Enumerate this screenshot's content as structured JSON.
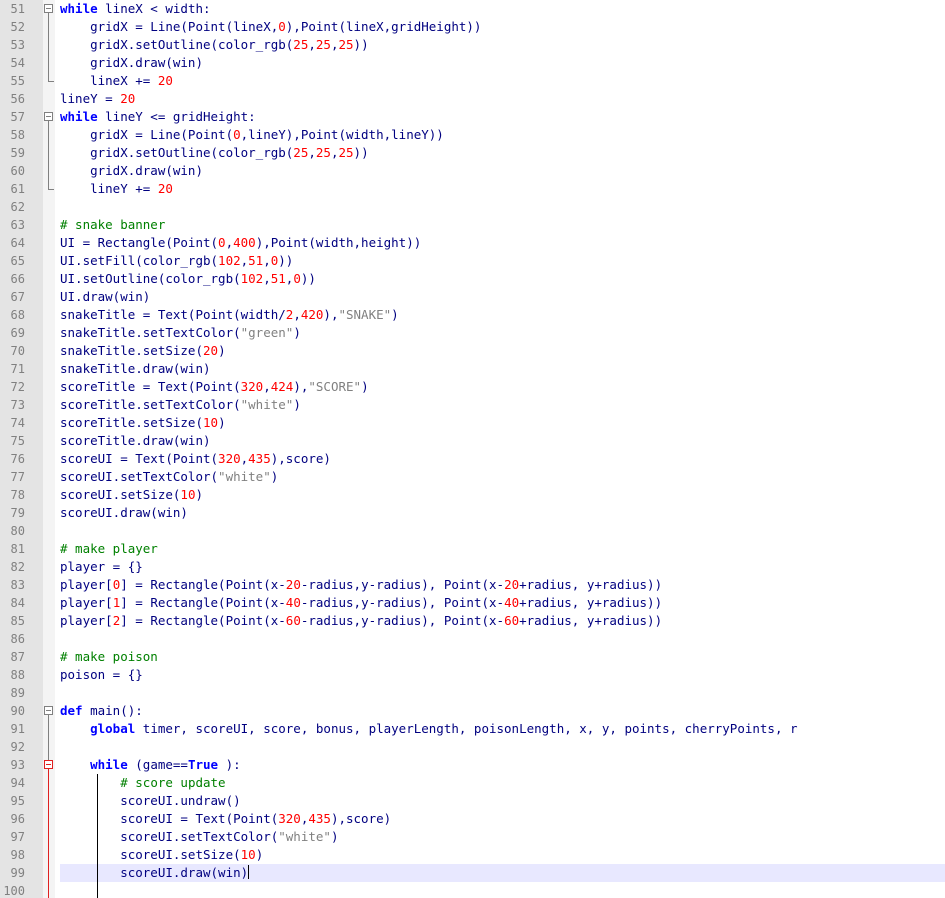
{
  "editor": {
    "lines": [
      {
        "n": "51",
        "segs": [
          [
            "kw",
            "while"
          ],
          [
            "",
            "lineX < width:"
          ]
        ]
      },
      {
        "n": "52",
        "segs": [
          [
            "",
            "    gridX = Line(Point(lineX,"
          ],
          [
            "nm",
            "0"
          ],
          [
            "",
            "),Point(lineX,gridHeight))"
          ]
        ]
      },
      {
        "n": "53",
        "segs": [
          [
            "",
            "    gridX.setOutline(color_rgb("
          ],
          [
            "nm",
            "25"
          ],
          [
            "",
            ","
          ],
          [
            "nm",
            "25"
          ],
          [
            "",
            ","
          ],
          [
            "nm",
            "25"
          ],
          [
            "",
            "))"
          ]
        ]
      },
      {
        "n": "54",
        "segs": [
          [
            "",
            "    gridX.draw(win)"
          ]
        ]
      },
      {
        "n": "55",
        "segs": [
          [
            "",
            "    lineX += "
          ],
          [
            "nm",
            "20"
          ]
        ]
      },
      {
        "n": "56",
        "segs": [
          [
            "",
            "lineY = "
          ],
          [
            "nm",
            "20"
          ]
        ]
      },
      {
        "n": "57",
        "segs": [
          [
            "kw",
            "while"
          ],
          [
            "",
            "lineY <= gridHeight:"
          ]
        ]
      },
      {
        "n": "58",
        "segs": [
          [
            "",
            "    gridX = Line(Point("
          ],
          [
            "nm",
            "0"
          ],
          [
            "",
            ",lineY),Point(width,lineY))"
          ]
        ]
      },
      {
        "n": "59",
        "segs": [
          [
            "",
            "    gridX.setOutline(color_rgb("
          ],
          [
            "nm",
            "25"
          ],
          [
            "",
            ","
          ],
          [
            "nm",
            "25"
          ],
          [
            "",
            ","
          ],
          [
            "nm",
            "25"
          ],
          [
            "",
            "))"
          ]
        ]
      },
      {
        "n": "60",
        "segs": [
          [
            "",
            "    gridX.draw(win)"
          ]
        ]
      },
      {
        "n": "61",
        "segs": [
          [
            "",
            "    lineY += "
          ],
          [
            "nm",
            "20"
          ]
        ]
      },
      {
        "n": "62",
        "segs": []
      },
      {
        "n": "63",
        "segs": [
          [
            "cm",
            "# snake banner"
          ]
        ]
      },
      {
        "n": "64",
        "segs": [
          [
            "",
            "UI = Rectangle(Point("
          ],
          [
            "nm",
            "0"
          ],
          [
            "",
            ","
          ],
          [
            "nm",
            "400"
          ],
          [
            "",
            "),Point(width,height))"
          ]
        ]
      },
      {
        "n": "65",
        "segs": [
          [
            "",
            "UI.setFill(color_rgb("
          ],
          [
            "nm",
            "102"
          ],
          [
            "",
            ","
          ],
          [
            "nm",
            "51"
          ],
          [
            "",
            ","
          ],
          [
            "nm",
            "0"
          ],
          [
            "",
            "))"
          ]
        ]
      },
      {
        "n": "66",
        "segs": [
          [
            "",
            "UI.setOutline(color_rgb("
          ],
          [
            "nm",
            "102"
          ],
          [
            "",
            ","
          ],
          [
            "nm",
            "51"
          ],
          [
            "",
            ","
          ],
          [
            "nm",
            "0"
          ],
          [
            "",
            "))"
          ]
        ]
      },
      {
        "n": "67",
        "segs": [
          [
            "",
            "UI.draw(win)"
          ]
        ]
      },
      {
        "n": "68",
        "segs": [
          [
            "",
            "snakeTitle = Text(Point(width/"
          ],
          [
            "nm",
            "2"
          ],
          [
            "",
            ","
          ],
          [
            "nm",
            "420"
          ],
          [
            "",
            "),"
          ],
          [
            "st",
            "\"SNAKE\""
          ],
          [
            "",
            ")"
          ]
        ]
      },
      {
        "n": "69",
        "segs": [
          [
            "",
            "snakeTitle.setTextColor("
          ],
          [
            "st",
            "\"green\""
          ],
          [
            "",
            ")"
          ]
        ]
      },
      {
        "n": "70",
        "segs": [
          [
            "",
            "snakeTitle.setSize("
          ],
          [
            "nm",
            "20"
          ],
          [
            "",
            ")"
          ]
        ]
      },
      {
        "n": "71",
        "segs": [
          [
            "",
            "snakeTitle.draw(win)"
          ]
        ]
      },
      {
        "n": "72",
        "segs": [
          [
            "",
            "scoreTitle = Text(Point("
          ],
          [
            "nm",
            "320"
          ],
          [
            "",
            ","
          ],
          [
            "nm",
            "424"
          ],
          [
            "",
            "),"
          ],
          [
            "st",
            "\"SCORE\""
          ],
          [
            "",
            ")"
          ]
        ]
      },
      {
        "n": "73",
        "segs": [
          [
            "",
            "scoreTitle.setTextColor("
          ],
          [
            "st",
            "\"white\""
          ],
          [
            "",
            ")"
          ]
        ]
      },
      {
        "n": "74",
        "segs": [
          [
            "",
            "scoreTitle.setSize("
          ],
          [
            "nm",
            "10"
          ],
          [
            "",
            ")"
          ]
        ]
      },
      {
        "n": "75",
        "segs": [
          [
            "",
            "scoreTitle.draw(win)"
          ]
        ]
      },
      {
        "n": "76",
        "segs": [
          [
            "",
            "scoreUI = Text(Point("
          ],
          [
            "nm",
            "320"
          ],
          [
            "",
            ","
          ],
          [
            "nm",
            "435"
          ],
          [
            "",
            "),score)"
          ]
        ]
      },
      {
        "n": "77",
        "segs": [
          [
            "",
            "scoreUI.setTextColor("
          ],
          [
            "st",
            "\"white\""
          ],
          [
            "",
            ")"
          ]
        ]
      },
      {
        "n": "78",
        "segs": [
          [
            "",
            "scoreUI.setSize("
          ],
          [
            "nm",
            "10"
          ],
          [
            "",
            ")"
          ]
        ]
      },
      {
        "n": "79",
        "segs": [
          [
            "",
            "scoreUI.draw(win)"
          ]
        ]
      },
      {
        "n": "80",
        "segs": []
      },
      {
        "n": "81",
        "segs": [
          [
            "cm",
            "# make player"
          ]
        ]
      },
      {
        "n": "82",
        "segs": [
          [
            "",
            "player = {}"
          ]
        ]
      },
      {
        "n": "83",
        "segs": [
          [
            "",
            "player["
          ],
          [
            "nm",
            "0"
          ],
          [
            "",
            "] = Rectangle(Point(x-"
          ],
          [
            "nm",
            "20"
          ],
          [
            "",
            "-radius,y-radius), Point(x-"
          ],
          [
            "nm",
            "20"
          ],
          [
            "",
            "+radius, y+radius))"
          ]
        ]
      },
      {
        "n": "84",
        "segs": [
          [
            "",
            "player["
          ],
          [
            "nm",
            "1"
          ],
          [
            "",
            "] = Rectangle(Point(x-"
          ],
          [
            "nm",
            "40"
          ],
          [
            "",
            "-radius,y-radius), Point(x-"
          ],
          [
            "nm",
            "40"
          ],
          [
            "",
            "+radius, y+radius))"
          ]
        ]
      },
      {
        "n": "85",
        "segs": [
          [
            "",
            "player["
          ],
          [
            "nm",
            "2"
          ],
          [
            "",
            "] = Rectangle(Point(x-"
          ],
          [
            "nm",
            "60"
          ],
          [
            "",
            "-radius,y-radius), Point(x-"
          ],
          [
            "nm",
            "60"
          ],
          [
            "",
            "+radius, y+radius))"
          ]
        ]
      },
      {
        "n": "86",
        "segs": []
      },
      {
        "n": "87",
        "segs": [
          [
            "cm",
            "# make poison"
          ]
        ]
      },
      {
        "n": "88",
        "segs": [
          [
            "",
            "poison = {}"
          ]
        ]
      },
      {
        "n": "89",
        "segs": []
      },
      {
        "n": "90",
        "segs": [
          [
            "kw",
            "def"
          ],
          [
            "",
            "main():"
          ]
        ]
      },
      {
        "n": "91",
        "segs": [
          [
            "",
            "    "
          ],
          [
            "kw",
            "global"
          ],
          [
            "",
            "timer, scoreUI, score, bonus, playerLength, poisonLength, x, y, points, cherryPoints, r"
          ]
        ]
      },
      {
        "n": "92",
        "segs": []
      },
      {
        "n": "93",
        "segs": [
          [
            "",
            "    "
          ],
          [
            "kw",
            "while"
          ],
          [
            "",
            "(game=="
          ],
          [
            "kw",
            "True"
          ],
          [
            "",
            "):"
          ]
        ]
      },
      {
        "n": "94",
        "segs": [
          [
            "",
            "        "
          ],
          [
            "cm",
            "# score update"
          ]
        ]
      },
      {
        "n": "95",
        "segs": [
          [
            "",
            "        scoreUI.undraw()"
          ]
        ]
      },
      {
        "n": "96",
        "segs": [
          [
            "",
            "        scoreUI = Text(Point("
          ],
          [
            "nm",
            "320"
          ],
          [
            "",
            ","
          ],
          [
            "nm",
            "435"
          ],
          [
            "",
            "),score)"
          ]
        ]
      },
      {
        "n": "97",
        "segs": [
          [
            "",
            "        scoreUI.setTextColor("
          ],
          [
            "st",
            "\"white\""
          ],
          [
            "",
            ")"
          ]
        ]
      },
      {
        "n": "98",
        "segs": [
          [
            "",
            "        scoreUI.setSize("
          ],
          [
            "nm",
            "10"
          ],
          [
            "",
            ")"
          ]
        ]
      },
      {
        "n": "99",
        "segs": [
          [
            "",
            "        scoreUI.draw(win)"
          ]
        ],
        "current": true
      },
      {
        "n": "100",
        "segs": []
      }
    ]
  },
  "colors": {
    "keyword": "#0000ff",
    "number": "#ff0000",
    "string": "#808080",
    "comment": "#008000",
    "default": "#000080",
    "gutter": "#e4e4e4",
    "current_line": "#e8e8ff"
  },
  "icons": [
    "fold-minus-icon",
    "fold-line-icon",
    "text-caret-icon"
  ]
}
